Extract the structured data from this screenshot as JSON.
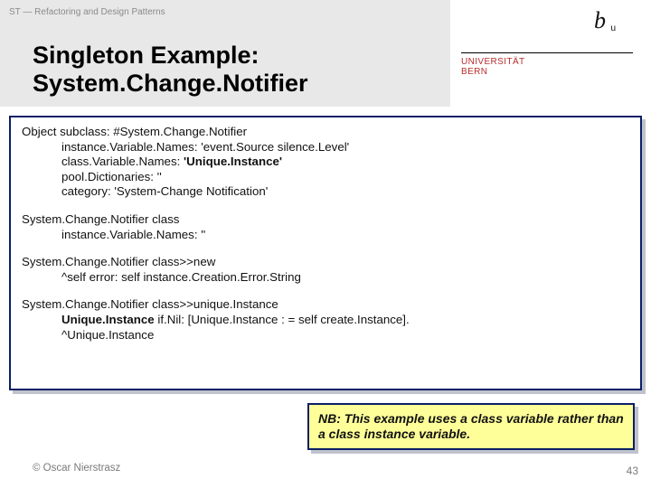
{
  "header": {
    "kicker": "ST — Refactoring and Design Patterns",
    "title_line1": "Singleton Example:",
    "title_line2": "System.Change.Notifier"
  },
  "university": {
    "logo_b": "b",
    "logo_u": "u",
    "name_line1": "UNIVERSITÄT",
    "name_line2": "BERN"
  },
  "code": {
    "block1": {
      "l1": "Object subclass: #System.Change.Notifier",
      "l2": "instance.Variable.Names: 'event.Source silence.Level'",
      "l3_prefix": "class.Variable.Names: ",
      "l3_bold": "'Unique.Instance'",
      "l4": "pool.Dictionaries: ''",
      "l5": "category: 'System-Change Notification'"
    },
    "block2": {
      "l1": "System.Change.Notifier class",
      "l2": "instance.Variable.Names: ''"
    },
    "block3": {
      "l1": "System.Change.Notifier class>>new",
      "l2": "^self error: self instance.Creation.Error.String"
    },
    "block4": {
      "l1": "System.Change.Notifier class>>unique.Instance",
      "l2_bold": "Unique.Instance",
      "l2_rest": " if.Nil: [Unique.Instance : = self create.Instance].",
      "l3": "^Unique.Instance"
    }
  },
  "note": {
    "text": "NB: This example uses a class variable rather than a class instance variable."
  },
  "footer": {
    "copyright": "© Oscar Nierstrasz",
    "page": "43"
  }
}
